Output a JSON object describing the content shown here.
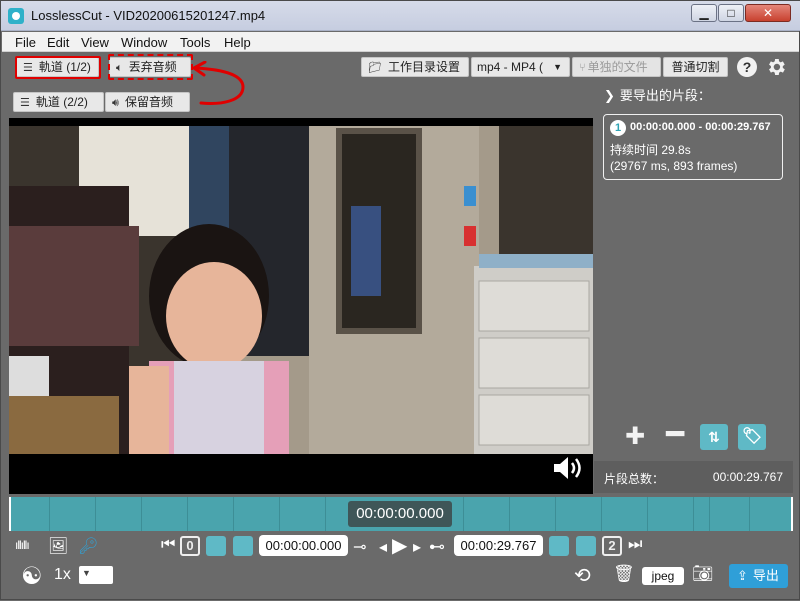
{
  "window": {
    "title": "LosslessCut - VID20200615201247.mp4",
    "controls": {
      "minimize": "▁",
      "maximize": "□",
      "close": "✕"
    }
  },
  "menu": [
    "File",
    "Edit",
    "View",
    "Window",
    "Tools",
    "Help"
  ],
  "toolbar": {
    "track1": "軌道 (1/2)",
    "discard_audio": "丟弃音频",
    "track2": "軌道 (2/2)",
    "keep_audio": "保留音频",
    "working_dir": "工作目录设置",
    "format": "mp4 - MP4 (",
    "separate_files": "单独的文件",
    "cut_mode": "普通切割",
    "help_icon": "?"
  },
  "segments": {
    "header": "要导出的片段：",
    "items": [
      {
        "index": "1",
        "range": "00:00:00.000 - 00:00:29.767",
        "duration": "持续时间 29.8s",
        "frames": "(29767 ms, 893 frames)"
      }
    ],
    "total_label": "片段总数：",
    "total_value": "00:00:29.767"
  },
  "timeline": {
    "current": "00:00:00.000"
  },
  "controls": {
    "start_chip": "0",
    "end_chip": "2",
    "start_time": "00:00:00.000",
    "end_time": "00:00:29.767",
    "speed": "1x",
    "capture_format": "jpeg",
    "export": "导出"
  },
  "colors": {
    "accent": "#4aa4ad",
    "export": "#2f9fd8",
    "annotation": "#e00000"
  }
}
